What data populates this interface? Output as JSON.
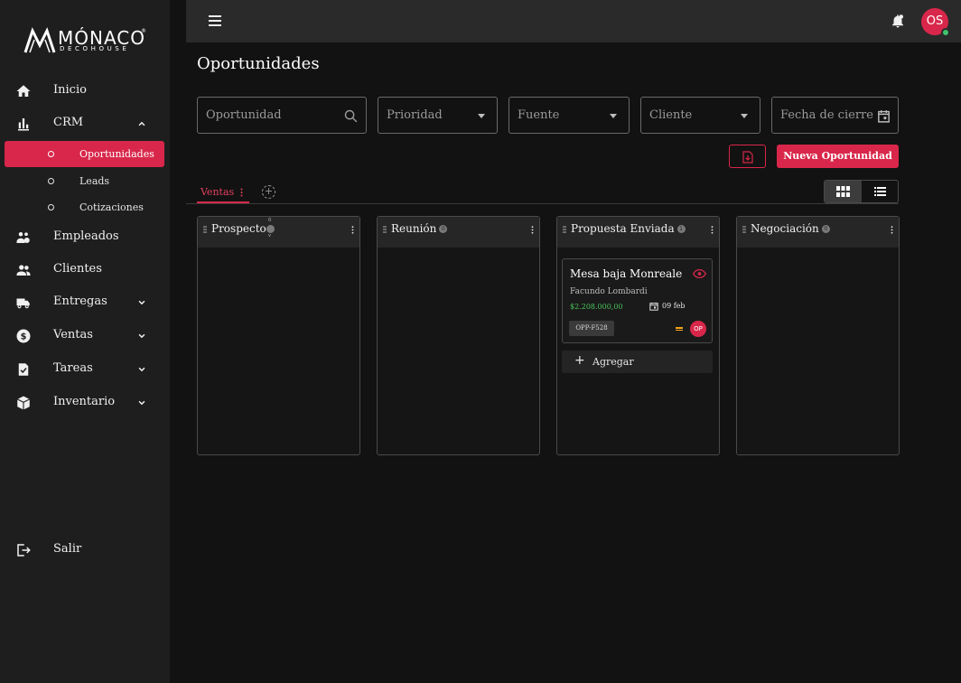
{
  "brand": {
    "name": "MÓNACO",
    "registered": "®",
    "tagline": "DECOHOUSE"
  },
  "sidebar": {
    "items": [
      {
        "label": "Inicio",
        "icon": "home-icon"
      },
      {
        "label": "CRM",
        "icon": "bar-chart-icon",
        "expanded": true,
        "children": [
          {
            "label": "Oportunidades",
            "active": true
          },
          {
            "label": "Leads"
          },
          {
            "label": "Cotizaciones"
          }
        ]
      },
      {
        "label": "Empleados",
        "icon": "employees-icon"
      },
      {
        "label": "Clientes",
        "icon": "people-icon"
      },
      {
        "label": "Entregas",
        "icon": "truck-icon"
      },
      {
        "label": "Ventas",
        "icon": "dollar-icon"
      },
      {
        "label": "Tareas",
        "icon": "task-icon"
      },
      {
        "label": "Inventario",
        "icon": "box-icon"
      }
    ],
    "logout": {
      "label": "Salir",
      "icon": "logout-icon"
    }
  },
  "topbar": {
    "user_initials": "OS",
    "user_status": "online"
  },
  "page": {
    "title": "Oportunidades"
  },
  "filters": {
    "search_placeholder": "Oportunidad",
    "priority_placeholder": "Prioridad",
    "source_placeholder": "Fuente",
    "client_placeholder": "Cliente",
    "close_date_placeholder": "Fecha de cierre"
  },
  "actions": {
    "new_label": "Nueva Oportunidad",
    "export_icon": "file-export-icon"
  },
  "pipelines": {
    "tabs": [
      {
        "label": "Ventas",
        "active": true
      }
    ],
    "add_label": "+"
  },
  "view_toggle": {
    "options": [
      "grid-view",
      "list-view"
    ],
    "selected": "grid-view"
  },
  "board": {
    "columns": [
      {
        "title": "Prospecto",
        "count_top": "0",
        "count_bottom": "v"
      },
      {
        "title": "Reunión",
        "count": "0"
      },
      {
        "title": "Propuesta Enviada",
        "count": "1",
        "cards": [
          {
            "title": "Mesa baja Monreale",
            "client": "Facundo Lombardi",
            "amount": "$2.208.000,00",
            "date": "09 feb",
            "code": "OPP-F528",
            "owner": "OP",
            "priority_color": "#f2a31b"
          }
        ],
        "add_label": "Agregar"
      },
      {
        "title": "Negociación",
        "count": "0"
      }
    ]
  },
  "colors": {
    "accent": "#d8274a",
    "amount": "#49c35a",
    "online": "#3ec46d"
  }
}
